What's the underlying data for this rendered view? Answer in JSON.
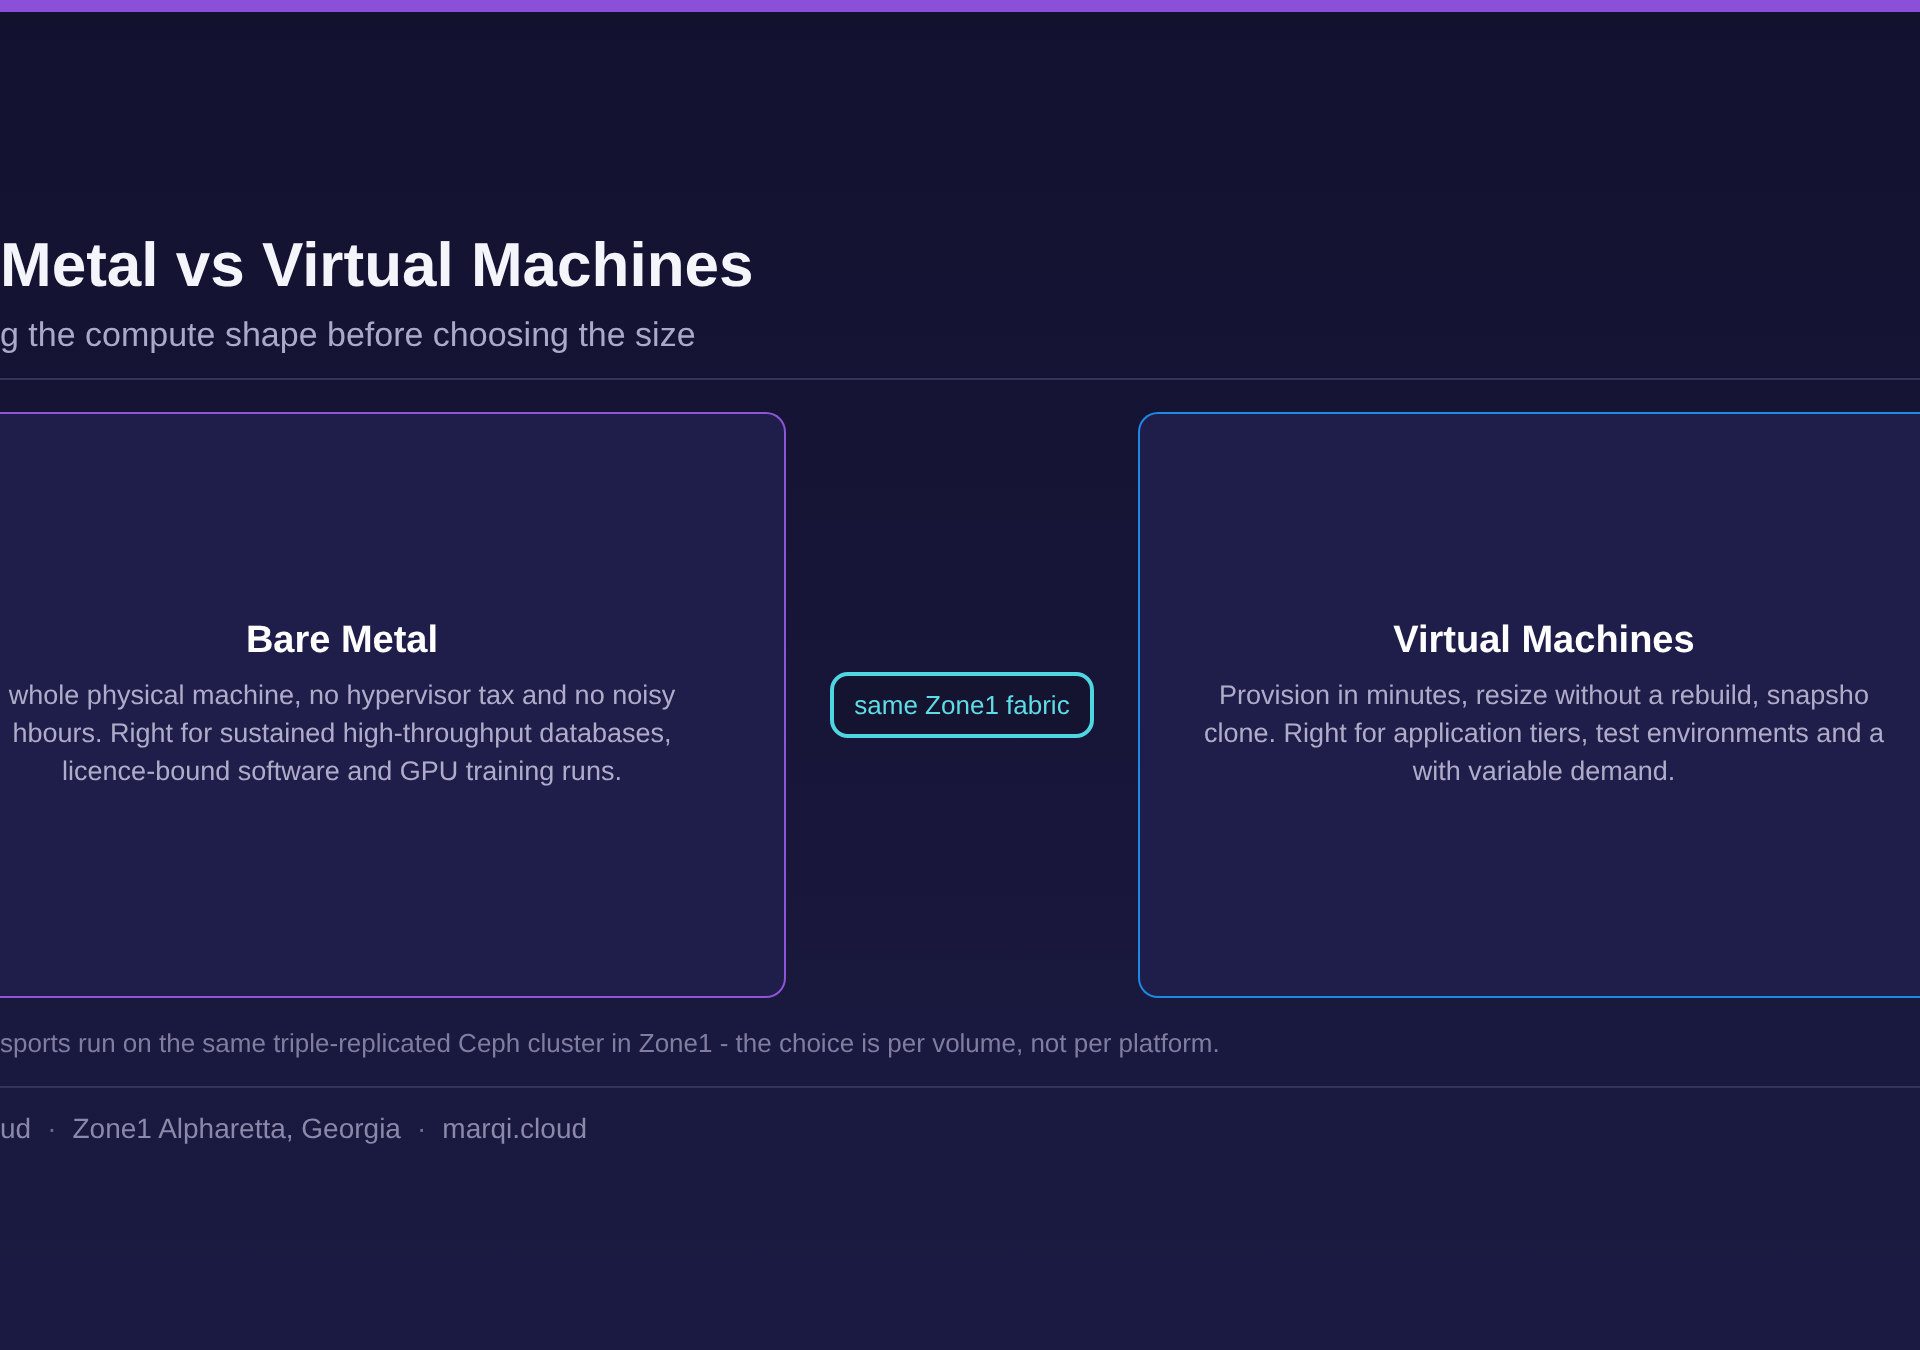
{
  "header": {
    "title": "Metal vs Virtual Machines",
    "subtitle": "g the compute shape before choosing the size"
  },
  "cards": [
    {
      "title": "Bare Metal",
      "body_lines": [
        "whole physical machine, no hypervisor tax and no noisy",
        "hbours. Right for sustained high-throughput databases,",
        "licence-bound software and GPU training runs."
      ],
      "color": "#8e55d8"
    },
    {
      "title": "Virtual Machines",
      "body_lines": [
        "Provision in minutes, resize without a rebuild, snapsho",
        "clone. Right for application tiers, test environments and a",
        "with variable demand."
      ],
      "color": "#1e88e5"
    }
  ],
  "connector": {
    "label": "same Zone1 fabric"
  },
  "note": "sports run on the same triple-replicated Ceph cluster in Zone1 - the choice is per volume, not per platform.",
  "footer": {
    "items": [
      "ud",
      "Zone1 Alpharetta, Georgia",
      "marqi.cloud"
    ],
    "separator": "·"
  }
}
